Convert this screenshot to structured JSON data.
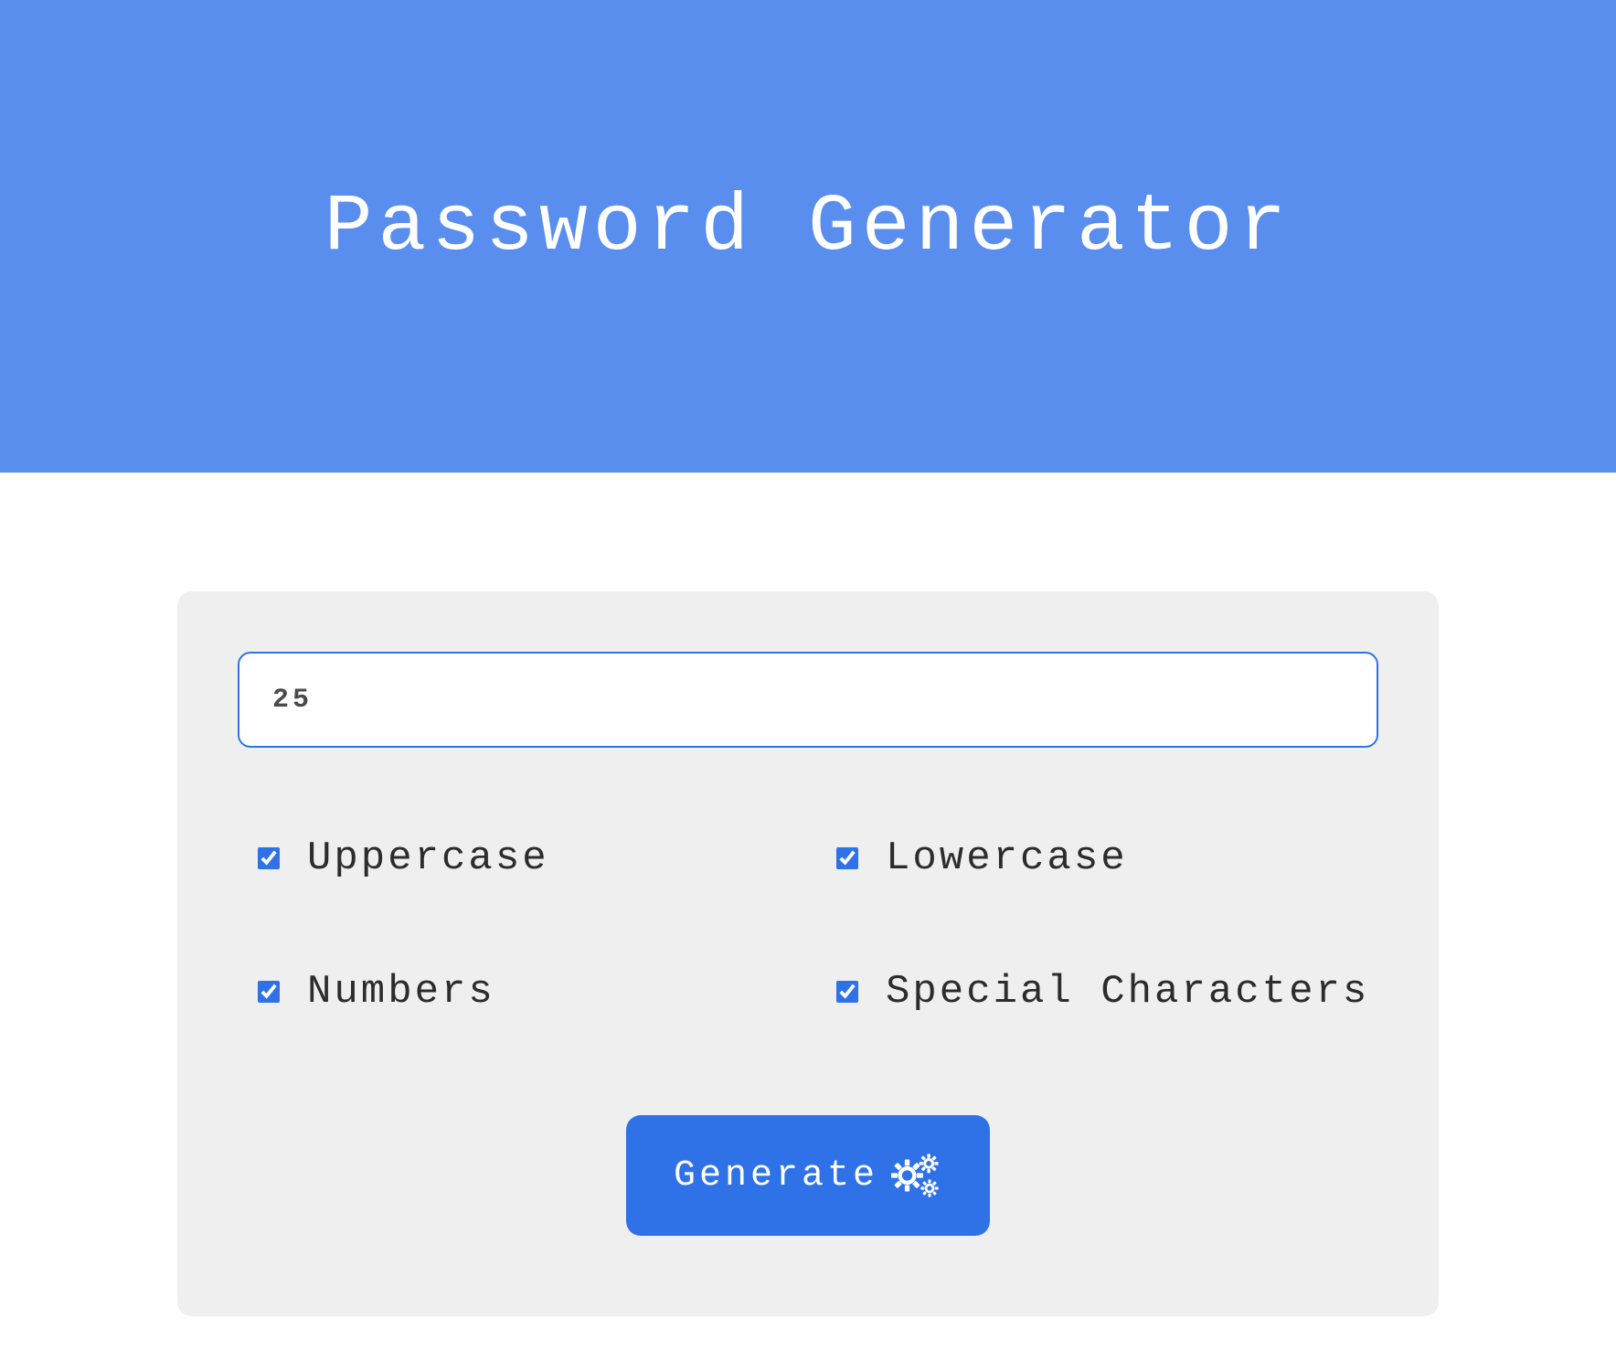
{
  "header": {
    "title": "Password Generator"
  },
  "form": {
    "length_value": "25",
    "options": [
      {
        "label": "Uppercase",
        "checked": true
      },
      {
        "label": "Lowercase",
        "checked": true
      },
      {
        "label": "Numbers",
        "checked": true
      },
      {
        "label": "Special Characters",
        "checked": true
      }
    ],
    "generate_label": "Generate"
  },
  "colors": {
    "header_bg": "#5a8eee",
    "card_bg": "#efefef",
    "accent": "#2f72e8",
    "text_dark": "#2c2c2c"
  }
}
